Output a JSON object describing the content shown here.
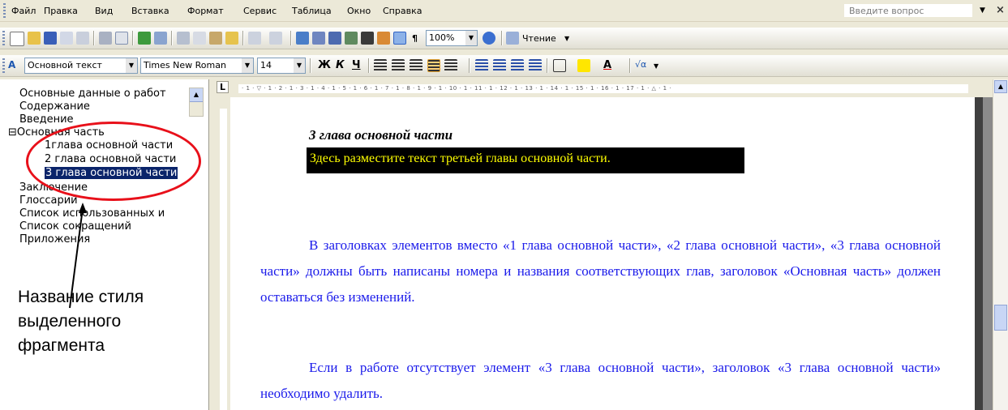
{
  "menu": {
    "items": [
      "Файл",
      "Правка",
      "Вид",
      "Вставка",
      "Формат",
      "Сервис",
      "Таблица",
      "Окно",
      "Справка"
    ],
    "help_placeholder": "Введите вопрос"
  },
  "toolbar_standard": {
    "zoom": "100%",
    "reading_label": "Чтение"
  },
  "toolbar_formatting": {
    "style": "Основной текст",
    "font": "Times New Roman",
    "size": "14"
  },
  "ruler": {
    "ticks": "· 1 · ▽ · 1 · 2 · 1 · 3 · 1 · 4 · 1 · 5 · 1 · 6 · 1 · 7 · 1 · 8 · 1 · 9 · 1 · 10 · 1 · 11 · 1 · 12 · 1 · 13 · 1 · 14 · 1 · 15 · 1 · 16 · 1 · 17 · 1 · △ · 1 ·"
  },
  "docmap": {
    "items": [
      "Основные данные о работ",
      "Содержание",
      "Введение",
      "⊟Основная часть",
      "1глава основной части",
      "2 глава основной части",
      "3 глава основной части",
      "Заключение",
      "Глоссарий",
      "Список использованных и",
      "Список сокращений",
      "Приложения"
    ],
    "selected_index": 6
  },
  "annotation": "Название стиля выделенного фрагмента",
  "document": {
    "heading": "3 глава основной части",
    "highlight": "Здесь разместите текст третьей главы основной части.",
    "paragraph1": "В заголовках элементов вместо «1 глава основной части», «2 глава основной части», «3 глава основной части» должны быть написаны номера и названия соответствующих глав, заголовок «Основная часть» должен оставаться без изменений.",
    "paragraph2": "Если в работе отсутствует элемент «3 глава основной части», заголовок «3 глава основной части» необходимо удалить."
  }
}
